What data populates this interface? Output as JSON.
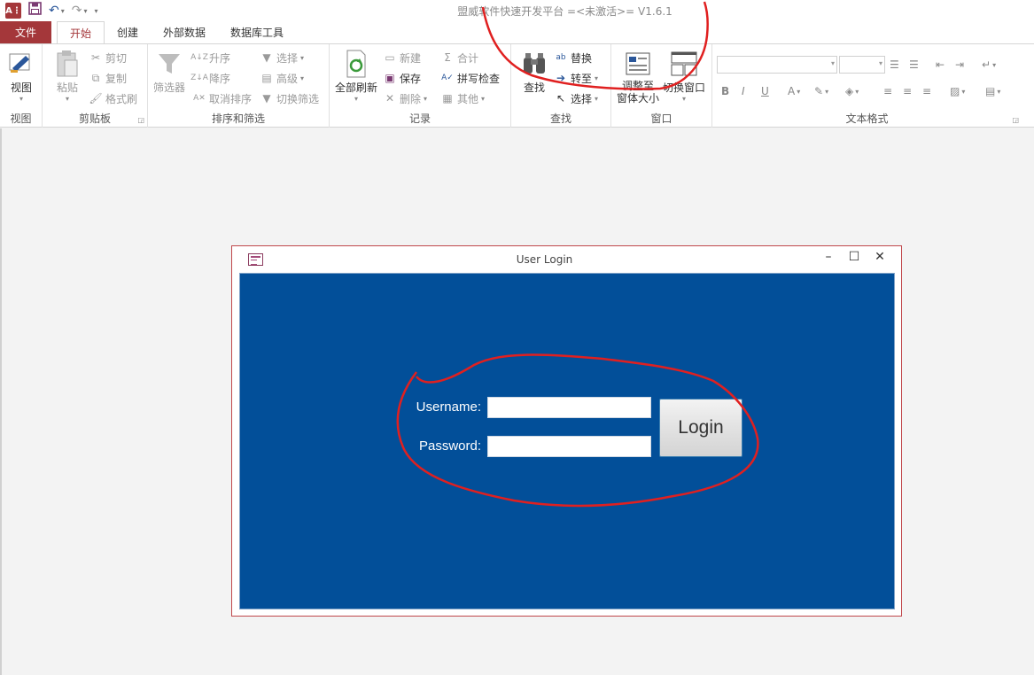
{
  "app": {
    "icon_text": "A⋮",
    "title": "盟威软件快速开发平台 =<未激活>= V1.6.1"
  },
  "tabs": [
    {
      "label": "文件"
    },
    {
      "label": "开始"
    },
    {
      "label": "创建"
    },
    {
      "label": "外部数据"
    },
    {
      "label": "数据库工具"
    }
  ],
  "ribbon": {
    "view": {
      "button": "视图",
      "group": "视图"
    },
    "clipboard": {
      "paste": "粘贴",
      "cut": "剪切",
      "copy": "复制",
      "format_painter": "格式刷",
      "group": "剪贴板"
    },
    "sort_filter": {
      "filter": "筛选器",
      "ascending": "升序",
      "descending": "降序",
      "clear_sort": "取消排序",
      "selection": "选择",
      "advanced": "高级",
      "toggle_filter": "切换筛选",
      "group": "排序和筛选"
    },
    "records": {
      "refresh_all": "全部刷新",
      "new": "新建",
      "save": "保存",
      "delete": "删除",
      "totals": "合计",
      "spelling": "拼写检查",
      "more": "其他",
      "group": "记录"
    },
    "find": {
      "find": "查找",
      "replace": "替换",
      "goto": "转至",
      "select": "选择",
      "group": "查找"
    },
    "window": {
      "fit_form": "调整至窗体大小",
      "fit_line1": "调整至",
      "fit_line2": "窗体大小",
      "switch_windows": "切换窗口",
      "group": "窗口"
    },
    "text_format": {
      "bold": "B",
      "italic": "I",
      "underline": "U",
      "font_color": "A",
      "group": "文本格式"
    }
  },
  "login_window": {
    "title": "User Login",
    "username_label": "Username:",
    "password_label": "Password:",
    "username_value": "",
    "password_value": "",
    "login_button": "Login",
    "background_color": "#024f99"
  },
  "colors": {
    "accent": "#a4373a",
    "annotation": "#e02020"
  }
}
